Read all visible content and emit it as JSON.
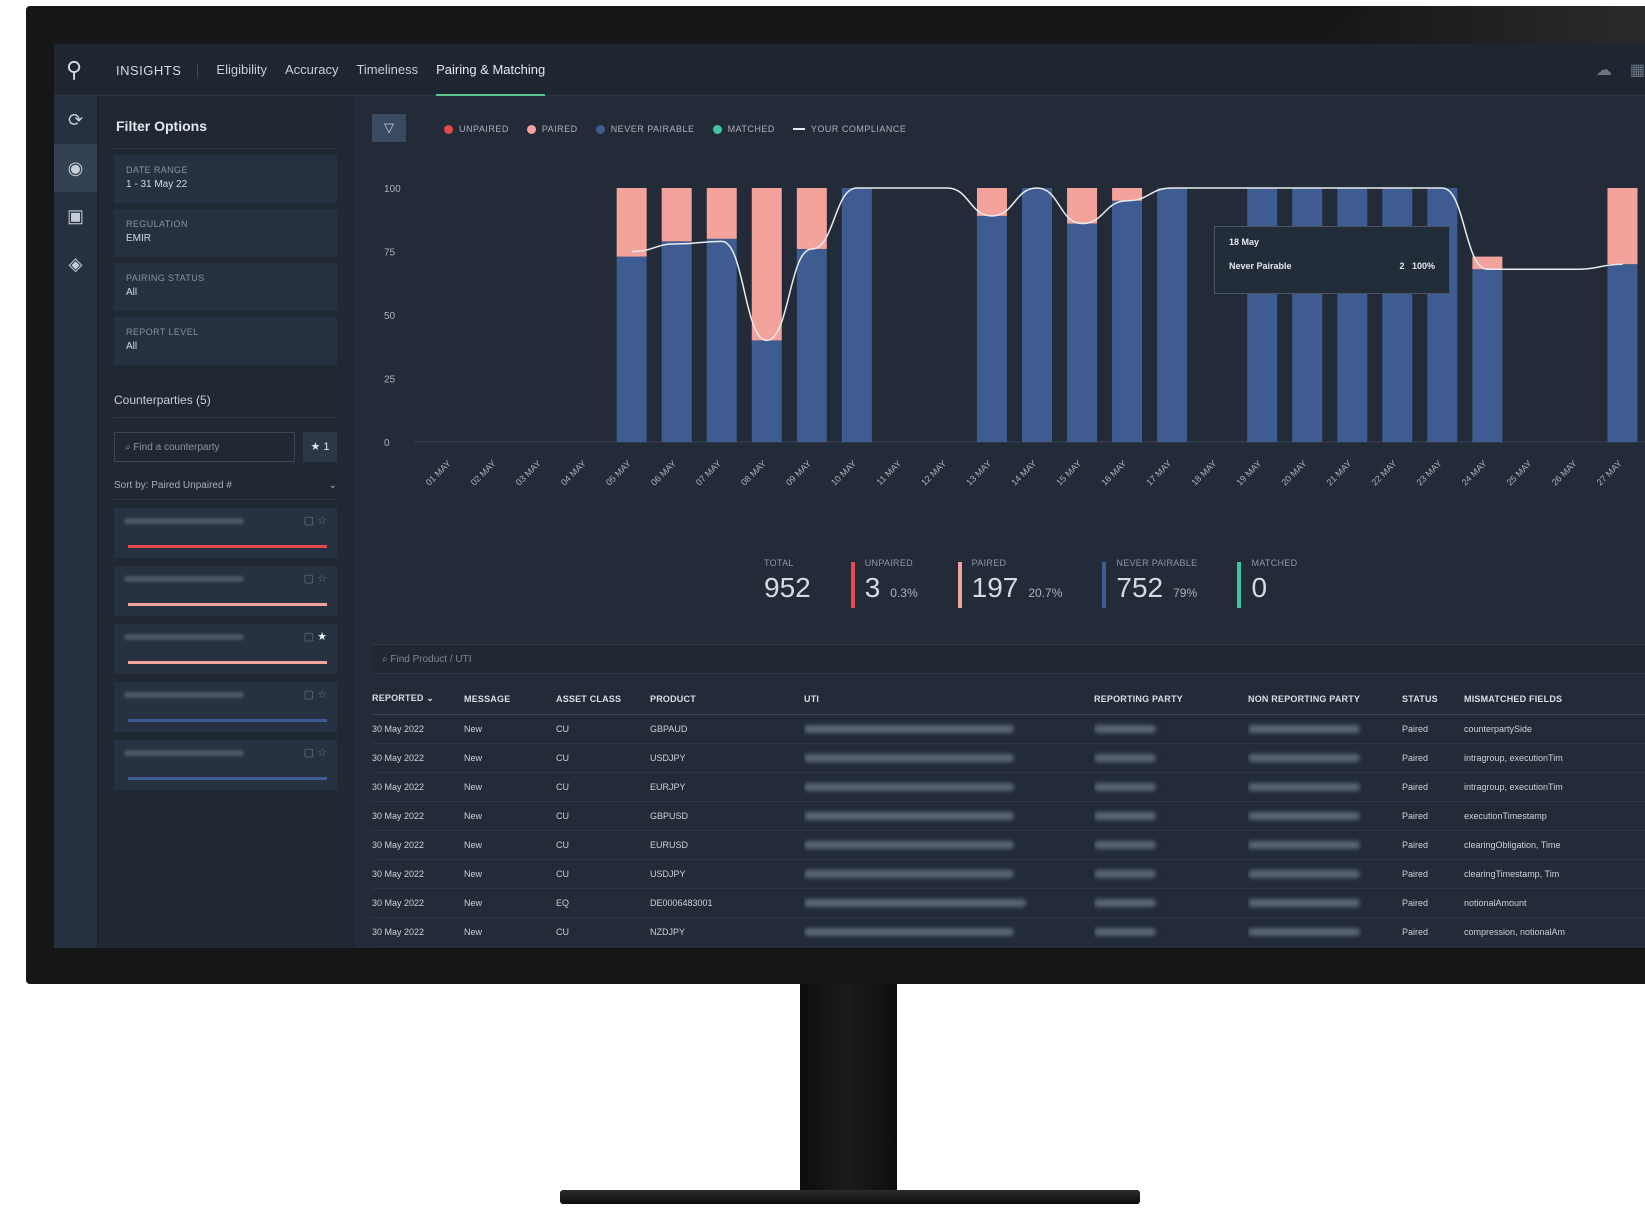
{
  "nav": {
    "brand": "INSIGHTS",
    "tabs": [
      "Eligibility",
      "Accuracy",
      "Timeliness",
      "Pairing & Matching"
    ],
    "active_tab": "Pairing & Matching"
  },
  "filters": {
    "title": "Filter Options",
    "items": [
      {
        "label": "DATE RANGE",
        "value": "1 - 31 May 22"
      },
      {
        "label": "REGULATION",
        "value": "EMIR"
      },
      {
        "label": "PAIRING STATUS",
        "value": "All"
      },
      {
        "label": "REPORT LEVEL",
        "value": "All"
      }
    ],
    "counterparties_title": "Counterparties (5)",
    "search_placeholder": "Find a counterparty",
    "fav_label": "★ 1",
    "sort_label": "Sort by:",
    "sort_value": "Paired Unpaired #"
  },
  "legend": {
    "unpaired": "UNPAIRED",
    "paired": "PAIRED",
    "never_pairable": "NEVER PAIRABLE",
    "matched": "MATCHED",
    "compliance": "YOUR COMPLIANCE"
  },
  "colors": {
    "unpaired": "#e5484d",
    "paired": "#f3a39b",
    "never_pairable": "#3e5c91",
    "matched": "#3dc7a4",
    "compliance": "#e8ecf0"
  },
  "chart_data": {
    "type": "bar",
    "stacked": true,
    "categories": [
      "01 MAY",
      "02 MAY",
      "03 MAY",
      "04 MAY",
      "05 MAY",
      "06 MAY",
      "07 MAY",
      "08 MAY",
      "09 MAY",
      "10 MAY",
      "11 MAY",
      "12 MAY",
      "13 MAY",
      "14 MAY",
      "15 MAY",
      "16 MAY",
      "17 MAY",
      "18 MAY",
      "19 MAY",
      "20 MAY",
      "21 MAY",
      "22 MAY",
      "23 MAY",
      "24 MAY",
      "25 MAY",
      "26 MAY",
      "27 MAY"
    ],
    "series": [
      {
        "name": "NEVER PAIRABLE",
        "values": [
          0,
          0,
          0,
          0,
          73,
          79,
          80,
          40,
          76,
          100,
          0,
          0,
          89,
          100,
          86,
          95,
          100,
          0,
          100,
          100,
          100,
          100,
          100,
          68,
          0,
          0,
          70
        ]
      },
      {
        "name": "PAIRED",
        "values": [
          0,
          0,
          0,
          0,
          27,
          21,
          20,
          60,
          24,
          0,
          0,
          0,
          11,
          0,
          14,
          5,
          0,
          0,
          0,
          0,
          0,
          0,
          0,
          5,
          0,
          0,
          30
        ]
      }
    ],
    "compliance_line": [
      null,
      null,
      null,
      null,
      75,
      78,
      79,
      40,
      76,
      100,
      100,
      100,
      89,
      100,
      86,
      95,
      100,
      100,
      100,
      100,
      100,
      100,
      100,
      68,
      68,
      68,
      70
    ],
    "ylim": [
      0,
      100
    ],
    "yticks": [
      0,
      25,
      50,
      75,
      100
    ]
  },
  "tooltip": {
    "date": "18 May",
    "label": "Never Pairable",
    "count": "2",
    "pct": "100%"
  },
  "stats": [
    {
      "label": "TOTAL",
      "value": "952",
      "pct": "",
      "color": ""
    },
    {
      "label": "UNPAIRED",
      "value": "3",
      "pct": "0.3%",
      "color": "#e5484d"
    },
    {
      "label": "PAIRED",
      "value": "197",
      "pct": "20.7%",
      "color": "#f3a39b"
    },
    {
      "label": "NEVER PAIRABLE",
      "value": "752",
      "pct": "79%",
      "color": "#3e5c91"
    },
    {
      "label": "MATCHED",
      "value": "0",
      "pct": "",
      "color": "#3dc7a4"
    }
  ],
  "table": {
    "search_placeholder": "Find Product / UTI",
    "headers": [
      "REPORTED",
      "MESSAGE",
      "ASSET CLASS",
      "PRODUCT",
      "UTI",
      "REPORTING PARTY",
      "NON REPORTING PARTY",
      "STATUS",
      "MISMATCHED FIELDS"
    ],
    "rows": [
      {
        "reported": "30 May 2022",
        "message": "New",
        "asset": "CU",
        "product": "GBPAUD",
        "status": "Paired",
        "fields": "counterpartySide"
      },
      {
        "reported": "30 May 2022",
        "message": "New",
        "asset": "CU",
        "product": "USDJPY",
        "status": "Paired",
        "fields": "intragroup, executionTim"
      },
      {
        "reported": "30 May 2022",
        "message": "New",
        "asset": "CU",
        "product": "EURJPY",
        "status": "Paired",
        "fields": "intragroup, executionTim"
      },
      {
        "reported": "30 May 2022",
        "message": "New",
        "asset": "CU",
        "product": "GBPUSD",
        "status": "Paired",
        "fields": "executionTimestamp"
      },
      {
        "reported": "30 May 2022",
        "message": "New",
        "asset": "CU",
        "product": "EURUSD",
        "status": "Paired",
        "fields": "clearingObligation, Time"
      },
      {
        "reported": "30 May 2022",
        "message": "New",
        "asset": "CU",
        "product": "USDJPY",
        "status": "Paired",
        "fields": "clearingTimestamp, Tim"
      },
      {
        "reported": "30 May 2022",
        "message": "New",
        "asset": "EQ",
        "product": "DE0006483001",
        "status": "Paired",
        "fields": "notionalAmount"
      },
      {
        "reported": "30 May 2022",
        "message": "New",
        "asset": "CU",
        "product": "NZDJPY",
        "status": "Paired",
        "fields": "compression, notionalAm"
      }
    ]
  }
}
